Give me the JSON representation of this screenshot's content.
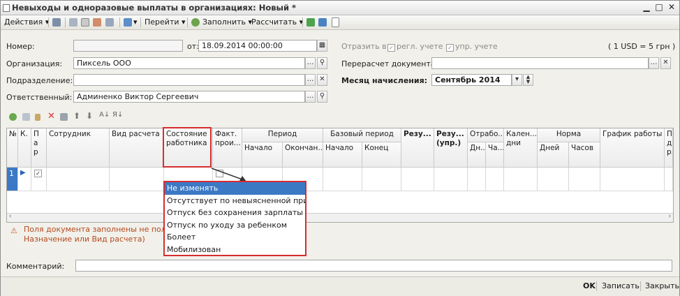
{
  "window": {
    "title": "Невыходы и одноразовые выплаты в организациях: Новый *"
  },
  "toolbar": {
    "actions": "Действия",
    "goto": "Перейти",
    "fill": "Заполнить",
    "calculate": "Рассчитать"
  },
  "form": {
    "number_label": "Номер:",
    "number_value": "",
    "from_label": "от:",
    "date_value": "18.09.2014 00:00:00",
    "reflect_label": "Отразить в:",
    "regl_label": "регл. учете",
    "upr_label": "упр. учете",
    "rate": "( 1 USD = 5 грн )",
    "org_label": "Организация:",
    "org_value": "Пиксель ООО",
    "recalc_label": "Перерасчет документа:",
    "recalc_value": "",
    "division_label": "Подразделение:",
    "division_value": "",
    "month_label": "Месяц начисления:",
    "month_value": "Сентябрь 2014",
    "responsible_label": "Ответственный:",
    "responsible_value": "Админенко Виктор Сергеевич"
  },
  "table": {
    "headers": {
      "num": "№",
      "k": "К.",
      "p": "П а р",
      "employee": "Сотрудник",
      "calc_type": "Вид расчета",
      "state": "Состояние работника",
      "fact": "Факт. прои...",
      "period": "Период",
      "start": "Начало",
      "end": "Окончан...",
      "base_period": "Базовый период",
      "base_start": "Начало",
      "base_end": "Конец",
      "result": "Резу...",
      "result_upr": "Резу... (упр.)",
      "worked": "Отрабо...",
      "days_short": "Дн...",
      "hours_short": "Ча...",
      "calendar_days": "Кален... дни",
      "norm": "Норма",
      "norm_days": "Дней",
      "norm_hours": "Часов",
      "schedule": "График работы",
      "last": "П... д... р..."
    },
    "rows": [
      {
        "num": "1"
      }
    ]
  },
  "dropdown": {
    "items": [
      "Не изменять",
      "Отсутствует по невыясненной прич...",
      "Отпуск без сохранения зарплаты",
      "Отпуск по уходу за ребенком",
      "Болеет",
      "Мобилизован"
    ],
    "selected": "Не изменять"
  },
  "warning": {
    "line1": "Поля документа заполнены не полностью",
    "line2": "Назначение или Вид расчета)"
  },
  "comment": {
    "label": "Комментарий:",
    "value": ""
  },
  "bottom": {
    "ok": "OK",
    "save": "Записать",
    "close": "Закрыть"
  },
  "colors": {
    "accent": "#3c79c5",
    "highlight": "#d62d2d",
    "warning": "#c8552c"
  }
}
